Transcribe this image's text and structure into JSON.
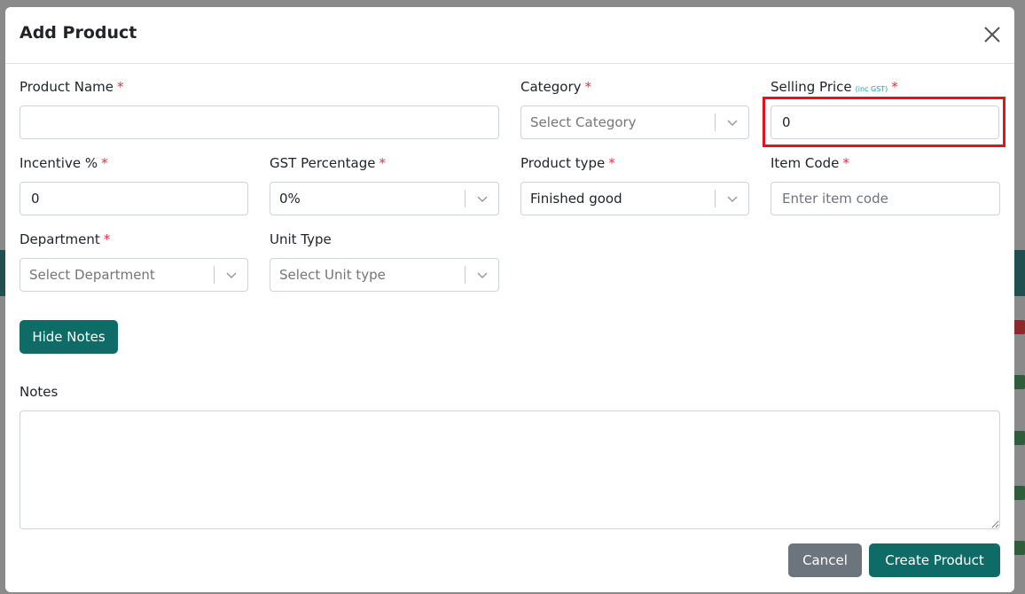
{
  "modal": {
    "title": "Add Product",
    "close_icon": "close-icon"
  },
  "fields": {
    "product_name": {
      "label": "Product Name",
      "required": "*",
      "value": "",
      "placeholder": ""
    },
    "category": {
      "label": "Category",
      "required": "*",
      "selected": "Select Category"
    },
    "selling_price": {
      "label": "Selling Price",
      "note": "(inc GST)",
      "required": "*",
      "value": "0"
    },
    "incentive": {
      "label": "Incentive %",
      "required": "*",
      "value": "0"
    },
    "gst_percentage": {
      "label": "GST Percentage",
      "required": "*",
      "selected": "0%"
    },
    "product_type": {
      "label": "Product type",
      "required": "*",
      "selected": "Finished good"
    },
    "item_code": {
      "label": "Item Code",
      "required": "*",
      "value": "",
      "placeholder": "Enter item code"
    },
    "department": {
      "label": "Department",
      "required": "*",
      "selected": "Select Department"
    },
    "unit_type": {
      "label": "Unit Type",
      "selected": "Select Unit type"
    },
    "notes": {
      "label": "Notes",
      "value": ""
    }
  },
  "buttons": {
    "hide_notes": "Hide Notes",
    "cancel": "Cancel",
    "create_product": "Create Product"
  },
  "colors": {
    "accent": "#0e6b66",
    "required": "#dc3545",
    "highlight": "#e0141e",
    "cancel": "#6c757d"
  }
}
